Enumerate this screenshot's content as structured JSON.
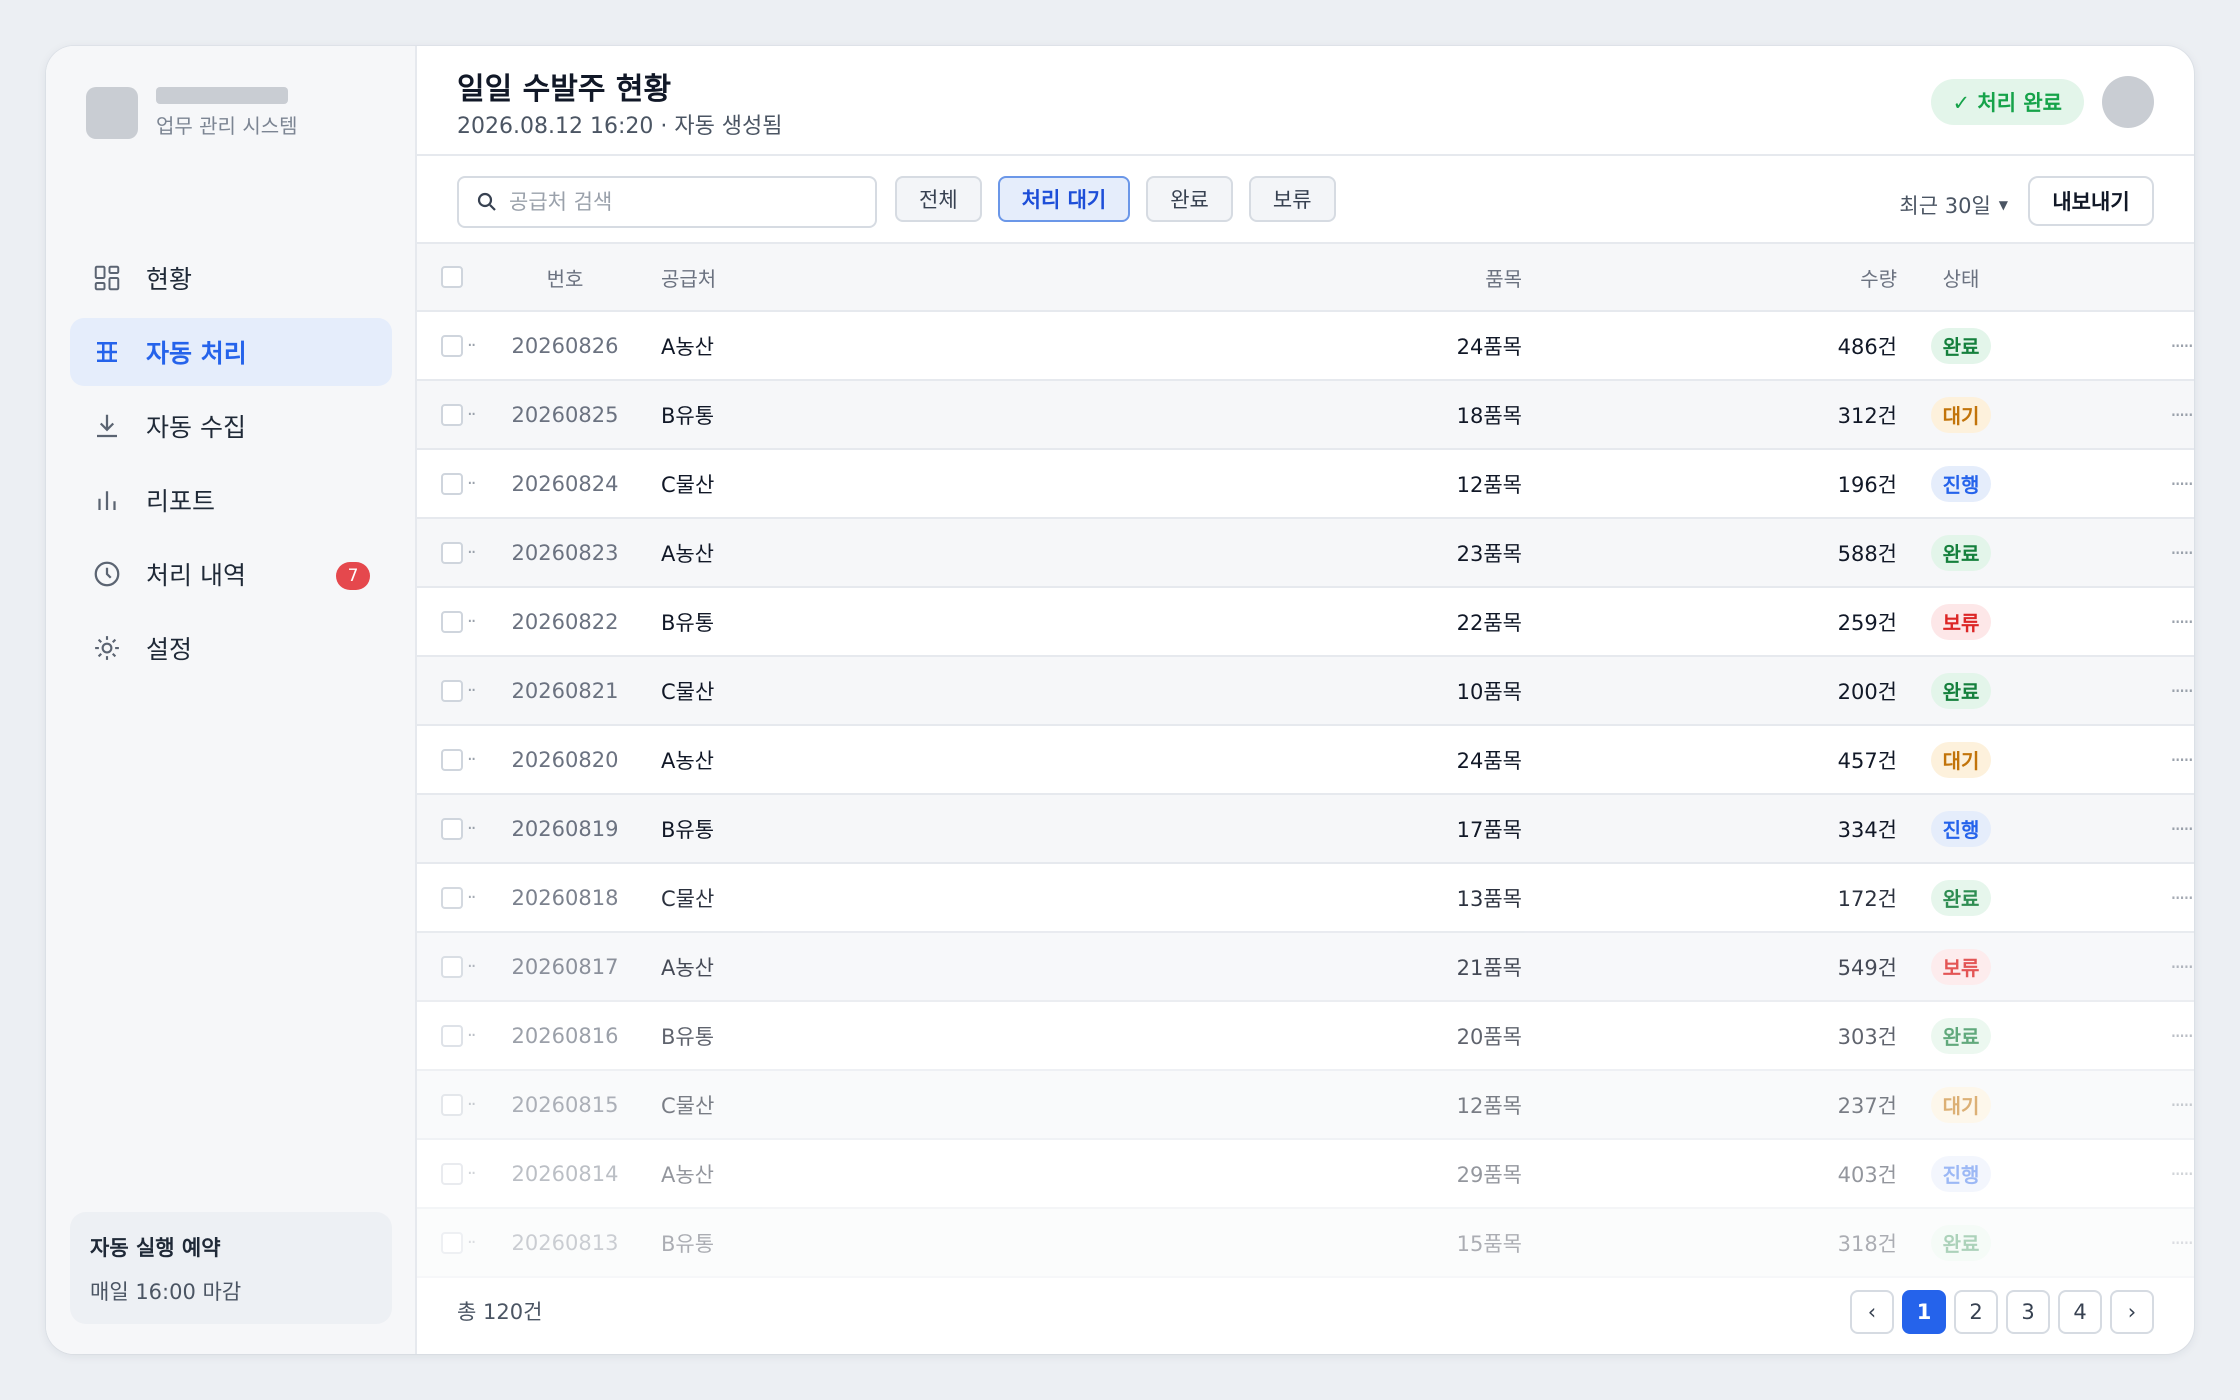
{
  "brand": {
    "subtitle": "업무 관리 시스템"
  },
  "sidebar": {
    "items": [
      {
        "label": "현황",
        "icon": "dashboard-grid-icon",
        "active": false
      },
      {
        "label": "자동 처리",
        "icon": "table-icon",
        "active": true
      },
      {
        "label": "자동 수집",
        "icon": "download-icon",
        "active": false
      },
      {
        "label": "리포트",
        "icon": "bar-chart-icon",
        "active": false
      },
      {
        "label": "처리 내역",
        "icon": "clock-icon",
        "active": false,
        "badge": "7"
      },
      {
        "label": "설정",
        "icon": "gear-icon",
        "active": false
      }
    ],
    "schedule": {
      "title": "자동 실행 예약",
      "time": "매일 16:00 마감"
    }
  },
  "header": {
    "title": "일일 수발주 현황",
    "subtitle": "2026.08.12 16:20 · 자동 생성됨",
    "status": "✓ 처리 완료"
  },
  "toolbar": {
    "search_placeholder": "공급처 검색",
    "filters": [
      "전체",
      "처리 대기",
      "완료",
      "보류"
    ],
    "active_filter": "처리 대기",
    "range": "최근 30일",
    "export": "내보내기"
  },
  "table": {
    "columns": {
      "no": "번호",
      "supplier": "공급처",
      "items": "품목",
      "qty": "수량",
      "status": "상태"
    },
    "rows": [
      {
        "no": "20260826",
        "supplier": "A농산",
        "items": "24품목",
        "qty": "486건",
        "status": "완료"
      },
      {
        "no": "20260825",
        "supplier": "B유통",
        "items": "18품목",
        "qty": "312건",
        "status": "대기"
      },
      {
        "no": "20260824",
        "supplier": "C물산",
        "items": "12품목",
        "qty": "196건",
        "status": "진행"
      },
      {
        "no": "20260823",
        "supplier": "A농산",
        "items": "23품목",
        "qty": "588건",
        "status": "완료"
      },
      {
        "no": "20260822",
        "supplier": "B유통",
        "items": "22품목",
        "qty": "259건",
        "status": "보류"
      },
      {
        "no": "20260821",
        "supplier": "C물산",
        "items": "10품목",
        "qty": "200건",
        "status": "완료"
      },
      {
        "no": "20260820",
        "supplier": "A농산",
        "items": "24품목",
        "qty": "457건",
        "status": "대기"
      },
      {
        "no": "20260819",
        "supplier": "B유통",
        "items": "17품목",
        "qty": "334건",
        "status": "진행"
      },
      {
        "no": "20260818",
        "supplier": "C물산",
        "items": "13품목",
        "qty": "172건",
        "status": "완료"
      },
      {
        "no": "20260817",
        "supplier": "A농산",
        "items": "21품목",
        "qty": "549건",
        "status": "보류"
      },
      {
        "no": "20260816",
        "supplier": "B유통",
        "items": "20품목",
        "qty": "303건",
        "status": "완료"
      },
      {
        "no": "20260815",
        "supplier": "C물산",
        "items": "12품목",
        "qty": "237건",
        "status": "대기"
      },
      {
        "no": "20260814",
        "supplier": "A농산",
        "items": "29품목",
        "qty": "403건",
        "status": "진행"
      },
      {
        "no": "20260813",
        "supplier": "B유통",
        "items": "15품목",
        "qty": "318건",
        "status": "완료"
      }
    ]
  },
  "footer": {
    "total": "총 120건",
    "pages": [
      "1",
      "2",
      "3",
      "4"
    ],
    "current_page": "1",
    "prev": "‹",
    "next": "›"
  },
  "colors": {
    "accent": "#2563eb",
    "done": "#15803d",
    "wait": "#c2740a",
    "progress": "#2563eb",
    "hold": "#dc2626"
  }
}
